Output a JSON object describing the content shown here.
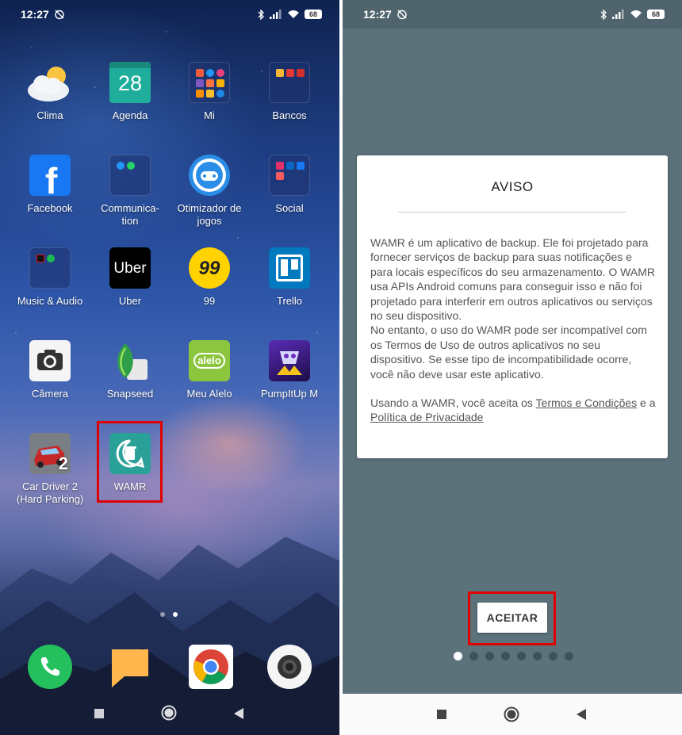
{
  "left_screen": {
    "status": {
      "time": "12:27",
      "battery": "68"
    },
    "apps": [
      {
        "label": "Clima",
        "icon": "weather-icon"
      },
      {
        "label": "Agenda",
        "icon": "calendar-icon",
        "icon_text": "28"
      },
      {
        "label": "Mi",
        "icon": "mi-folder-icon"
      },
      {
        "label": "Bancos",
        "icon": "banks-folder-icon"
      },
      {
        "label": "Facebook",
        "icon": "facebook-icon"
      },
      {
        "label": "Communica-\ntion",
        "icon": "communication-folder-icon"
      },
      {
        "label": "Otimizador de\njogos",
        "icon": "game-optimizer-icon"
      },
      {
        "label": "Social",
        "icon": "social-folder-icon"
      },
      {
        "label": "Music & Audio",
        "icon": "music-folder-icon"
      },
      {
        "label": "Uber",
        "icon": "uber-icon",
        "icon_text": "Uber"
      },
      {
        "label": "99",
        "icon": "99-icon",
        "icon_text": "99"
      },
      {
        "label": "Trello",
        "icon": "trello-icon"
      },
      {
        "label": "Câmera",
        "icon": "camera-icon"
      },
      {
        "label": "Snapseed",
        "icon": "snapseed-icon"
      },
      {
        "label": "Meu Alelo",
        "icon": "alelo-icon",
        "icon_text": "alelo"
      },
      {
        "label": "PumpItUp M",
        "icon": "pumpitup-icon"
      },
      {
        "label": "Car Driver 2\n(Hard Parking)",
        "icon": "car-driver-icon",
        "icon_text": "2"
      },
      {
        "label": "WAMR",
        "icon": "wamr-icon"
      }
    ],
    "dock": [
      {
        "name": "phone-icon"
      },
      {
        "name": "messages-icon"
      },
      {
        "name": "chrome-icon"
      },
      {
        "name": "camera-app-icon"
      }
    ],
    "page_indicator": {
      "pages": 2,
      "current": 2
    }
  },
  "right_screen": {
    "status": {
      "time": "12:27",
      "battery": "68"
    },
    "dialog": {
      "title": "AVISO",
      "paragraph1": "WAMR é um aplicativo de backup. Ele foi projetado para fornecer serviços de backup para suas notificações e para locais específicos do seu armazenamento. O WAMR usa APIs Android comuns para conseguir isso e não foi projetado para interferir em outros aplicativos ou serviços no seu dispositivo.",
      "paragraph2": "No entanto, o uso do WAMR pode ser incompatível com os Termos de Uso de outros aplicativos no seu dispositivo. Se esse tipo de incompatibilidade ocorre, você não deve usar este aplicativo.",
      "terms_prefix": "Usando a WAMR, você aceita os ",
      "terms_link": "Termos e Condições",
      "terms_middle": " e a ",
      "privacy_link": "Política de Privacidade"
    },
    "accept_button": "ACEITAR",
    "page_indicator": {
      "pages": 8,
      "current": 1
    }
  },
  "colors": {
    "highlight": "#e00000",
    "dialog_background": "#5c727b",
    "wamr_teal": "#2aa198"
  }
}
